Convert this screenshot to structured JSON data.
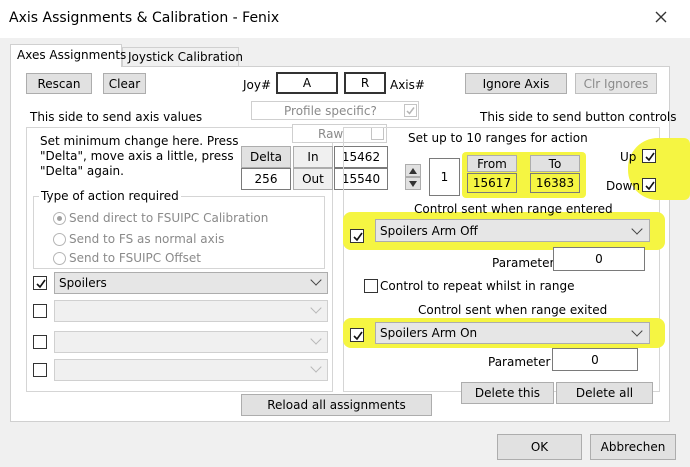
{
  "window": {
    "title": "Axis Assignments & Calibration - Fenix"
  },
  "tabs": [
    {
      "label": "Axes Assignments"
    },
    {
      "label": "Joystick Calibration"
    }
  ],
  "toolbar": {
    "rescan": "Rescan",
    "clear": "Clear",
    "joy_label": "Joy#",
    "joy_value": "A",
    "axis_value": "R",
    "axis_label": "Axis#",
    "ignore_axis": "Ignore Axis",
    "clr_ignores": "Clr Ignores"
  },
  "profile_specific": "Profile specific?",
  "left": {
    "heading": "This side to send axis values",
    "min_change_text": [
      "Set minimum change  here.  Press",
      "\"Delta\", move axis a little,  press",
      "\"Delta\" again."
    ],
    "delta_label": "Delta",
    "delta_value": "256",
    "raw_label": "Raw",
    "in_label": "In",
    "in_value": "15462",
    "out_label": "Out",
    "out_value": "15540",
    "action_group": "Type of action required",
    "radios": [
      {
        "label": "Send direct to FSUIPC Calibration",
        "selected": true
      },
      {
        "label": "Send to FS as normal axis",
        "selected": false
      },
      {
        "label": "Send to FSUIPC Offset",
        "selected": false
      }
    ],
    "controls": [
      {
        "checked": true,
        "value": "Spoilers"
      },
      {
        "checked": false,
        "value": ""
      },
      {
        "checked": false,
        "value": ""
      },
      {
        "checked": false,
        "value": ""
      }
    ]
  },
  "right": {
    "heading": "This side to send button controls",
    "ranges_label": "Set up to 10 ranges for action",
    "range_index": "1",
    "from_label": "From",
    "from_value": "15617",
    "to_label": "To",
    "to_value": "16383",
    "up_label": "Up",
    "up_checked": true,
    "down_label": "Down",
    "down_checked": true,
    "entered_label": "Control sent when range entered",
    "entered_checked": true,
    "entered_value": "Spoilers Arm Off",
    "param_label_1": "Parameter",
    "param_value_1": "0",
    "repeat_label": "Control to repeat whilst in range",
    "repeat_checked": false,
    "exited_label": "Control sent when range exited",
    "exited_checked": true,
    "exited_value": "Spoilers Arm On",
    "param_label_2": "Parameter",
    "param_value_2": "0",
    "delete_this": "Delete this",
    "delete_all": "Delete all"
  },
  "footer": {
    "reload": "Reload all assignments",
    "ok": "OK",
    "cancel": "Abbrechen"
  },
  "colors": {
    "highlight": "#f5f542"
  }
}
